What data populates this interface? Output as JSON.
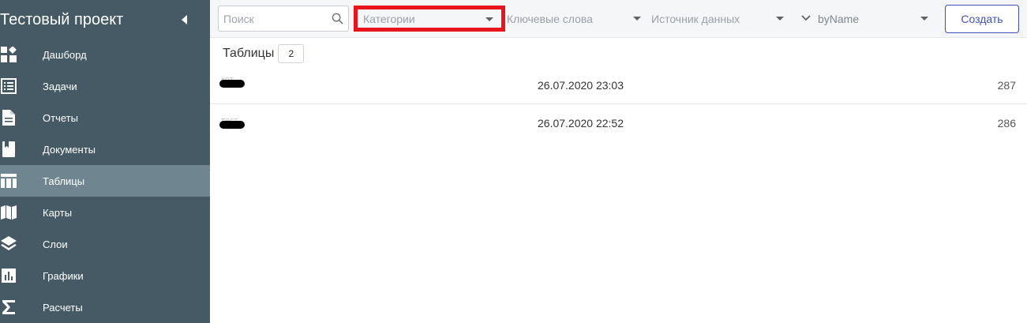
{
  "sidebar": {
    "project_title": "Тестовый проект",
    "items": [
      {
        "label": "Дашборд",
        "icon": "dashboard-icon"
      },
      {
        "label": "Задачи",
        "icon": "tasks-icon"
      },
      {
        "label": "Отчеты",
        "icon": "report-icon"
      },
      {
        "label": "Документы",
        "icon": "document-icon"
      },
      {
        "label": "Таблицы",
        "icon": "table-icon",
        "active": true
      },
      {
        "label": "Карты",
        "icon": "map-icon"
      },
      {
        "label": "Слои",
        "icon": "layers-icon"
      },
      {
        "label": "Графики",
        "icon": "chart-icon"
      },
      {
        "label": "Расчеты",
        "icon": "sigma-icon"
      }
    ]
  },
  "filters": {
    "search_placeholder": "Поиск",
    "categories_label": "Категории",
    "keywords_label": "Ключевые слова",
    "source_label": "Источник данных",
    "sort_label": "byName",
    "create_label": "Создать"
  },
  "content": {
    "section_title": "Таблицы",
    "count": "2",
    "rows": [
      {
        "name": "кот",
        "date": "26.07.2020 23:03",
        "count": "287"
      },
      {
        "name": "тест",
        "date": "26.07.2020 22:52",
        "count": "286"
      }
    ]
  },
  "colors": {
    "sidebar_bg": "#455a64",
    "sidebar_active": "#6f8690",
    "highlight_border": "#e8141c",
    "accent": "#3f51b5"
  }
}
